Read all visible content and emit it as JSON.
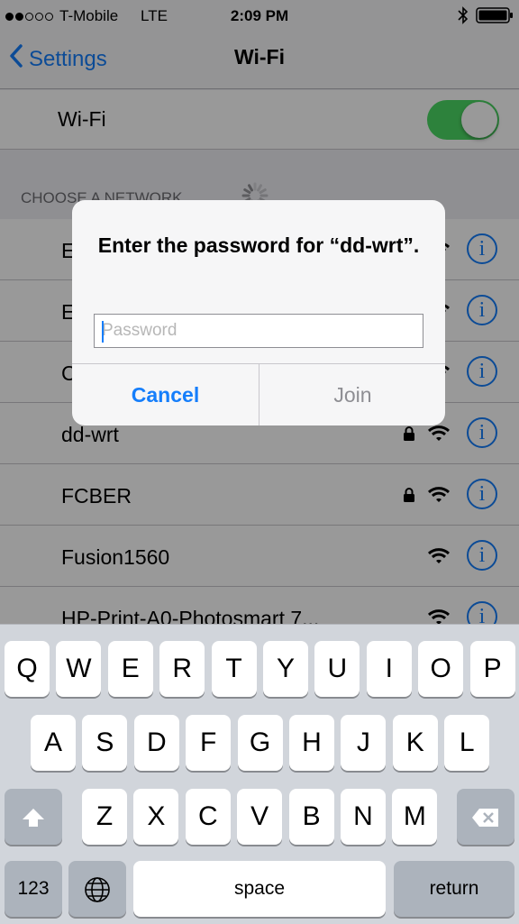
{
  "status_bar": {
    "signal_dots": 5,
    "signal_filled": 2,
    "carrier": "T-Mobile",
    "network": "LTE",
    "time": "2:09 PM"
  },
  "nav": {
    "back_label": "Settings",
    "title": "Wi-Fi"
  },
  "wifi_toggle": {
    "label": "Wi-Fi",
    "on": true
  },
  "section_header": "CHOOSE A NETWORK...",
  "networks": [
    {
      "name": "E",
      "locked": false
    },
    {
      "name": "E",
      "locked": false
    },
    {
      "name": "C",
      "locked": false
    },
    {
      "name": "dd-wrt",
      "locked": true
    },
    {
      "name": "FCBER",
      "locked": true
    },
    {
      "name": "Fusion1560",
      "locked": false
    },
    {
      "name": "HP-Print-A0-Photosmart 7...",
      "locked": false
    }
  ],
  "alert": {
    "title": "Enter the password for “dd-wrt”.",
    "password_placeholder": "Password",
    "password_value": "",
    "cancel_label": "Cancel",
    "join_label": "Join"
  },
  "keyboard": {
    "row1": [
      "Q",
      "W",
      "E",
      "R",
      "T",
      "Y",
      "U",
      "I",
      "O",
      "P"
    ],
    "row2": [
      "A",
      "S",
      "D",
      "F",
      "G",
      "H",
      "J",
      "K",
      "L"
    ],
    "row3": [
      "Z",
      "X",
      "C",
      "V",
      "B",
      "N",
      "M"
    ],
    "numbers_label": "123",
    "space_label": "space",
    "return_label": "return"
  },
  "colors": {
    "accent": "#157efb",
    "toggle_on": "#4cd964"
  }
}
